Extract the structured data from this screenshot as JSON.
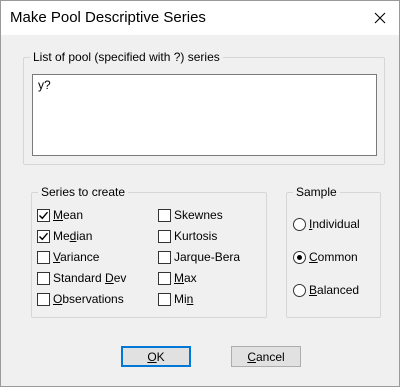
{
  "window": {
    "title": "Make Pool Descriptive Series",
    "close_icon": "close-icon"
  },
  "pool_list": {
    "label": "List of pool (specified with ?) series",
    "value": "y?"
  },
  "series_group": {
    "label": "Series to create",
    "col1": [
      {
        "pre": "",
        "acc": "M",
        "post": "ean",
        "checked": true
      },
      {
        "pre": "Me",
        "acc": "d",
        "post": "ian",
        "checked": true
      },
      {
        "pre": "",
        "acc": "V",
        "post": "ariance",
        "checked": false
      },
      {
        "pre": "Standard ",
        "acc": "D",
        "post": "ev",
        "checked": false
      },
      {
        "pre": "",
        "acc": "O",
        "post": "bservations",
        "checked": false
      }
    ],
    "col2": [
      {
        "pre": "Skewnes",
        "acc": "",
        "post": "",
        "checked": false
      },
      {
        "pre": "Kurtosis",
        "acc": "",
        "post": "",
        "checked": false
      },
      {
        "pre": "Jarque-Bera",
        "acc": "",
        "post": "",
        "checked": false
      },
      {
        "pre": "",
        "acc": "M",
        "post": "ax",
        "checked": false
      },
      {
        "pre": "Mi",
        "acc": "n",
        "post": "",
        "checked": false
      }
    ]
  },
  "sample_group": {
    "label": "Sample",
    "options": [
      {
        "pre": "",
        "acc": "I",
        "post": "ndividual",
        "selected": false
      },
      {
        "pre": "",
        "acc": "C",
        "post": "ommon",
        "selected": true
      },
      {
        "pre": "",
        "acc": "B",
        "post": "alanced",
        "selected": false
      }
    ]
  },
  "buttons": {
    "ok": {
      "acc": "O",
      "post": "K"
    },
    "cancel": {
      "acc": "C",
      "post": "ancel"
    }
  }
}
